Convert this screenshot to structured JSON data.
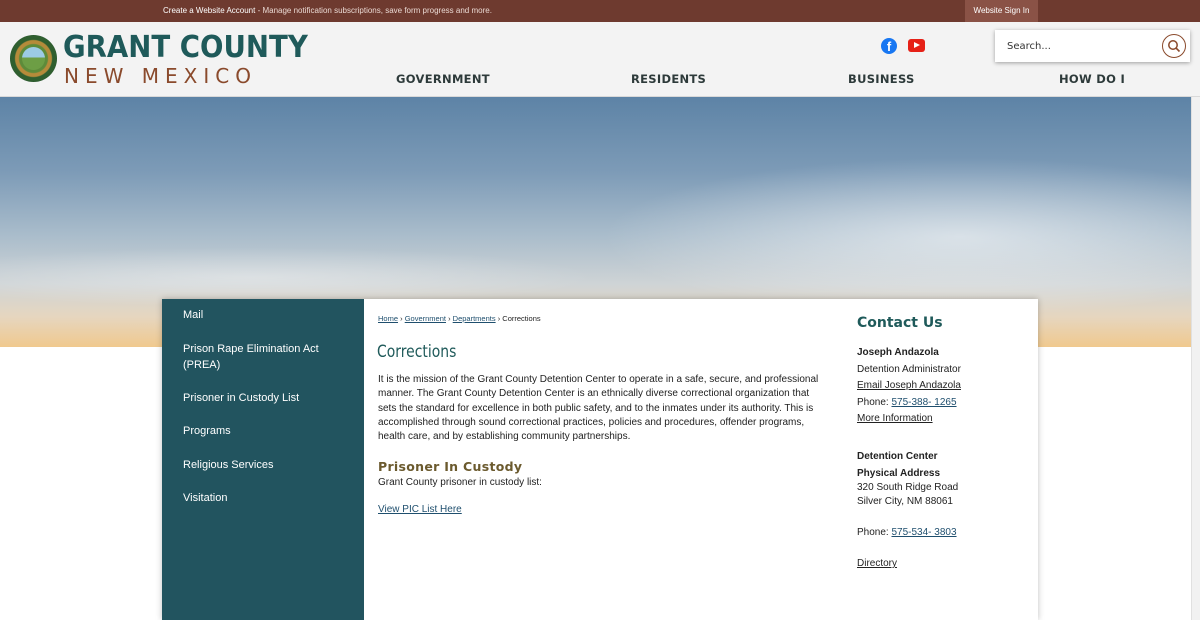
{
  "topbar": {
    "create_link": "Create a Website Account",
    "create_rest": " - Manage notification subscriptions, save form progress and more.",
    "signin": "Website Sign In"
  },
  "brand": {
    "title": "GRANT COUNTY",
    "subtitle": "NEW MEXICO"
  },
  "social": [
    {
      "icon": "facebook-icon",
      "color": "#1877f2"
    },
    {
      "icon": "youtube-icon",
      "color": "#e62117"
    }
  ],
  "search": {
    "placeholder": "Search..."
  },
  "nav": [
    "GOVERNMENT",
    "RESIDENTS",
    "BUSINESS",
    "HOW DO I"
  ],
  "sidebar": {
    "items": [
      "Mail",
      "Prison Rape Elimination Act (PREA)",
      "Prisoner in Custody List",
      "Programs",
      "Religious Services",
      "Visitation"
    ]
  },
  "breadcrumb": {
    "home": "Home",
    "government": "Government",
    "departments": "Departments",
    "current": "Corrections",
    "separator": "›"
  },
  "main": {
    "title": "Corrections",
    "mission": "It is the mission of the Grant County Detention Center to operate in a safe, secure, and professional manner. The Grant County Detention Center is an ethnically diverse correctional organization that sets the standard for excellence in both public safety, and to the inmates under its authority. This is accomplished through sound correctional practices, policies and procedures, offender programs, health care, and by establishing community partnerships.",
    "custody_heading": "Prisoner In Custody",
    "custody_text": "Grant County prisoner in custody list:",
    "custody_link": "View PIC List Here"
  },
  "contact": {
    "title": "Contact Us",
    "name": "Joseph Andazola",
    "role": "Detention Administrator",
    "email_link": "Email Joseph Andazola",
    "phone_label": "Phone: ",
    "phone": "575-388- 1265",
    "more": "More Information",
    "center": "Detention Center",
    "address_label": "Physical Address",
    "address1": "320 South Ridge Road",
    "address2": "Silver City, NM 88061",
    "phone2_label": "Phone: ",
    "phone2": "575-534- 3803",
    "directory": "Directory"
  },
  "colors": {
    "topbar": "#6e3a2f",
    "sidebar": "#22545f",
    "brand": "#1f5a5a",
    "accent": "#8a4a2c"
  }
}
